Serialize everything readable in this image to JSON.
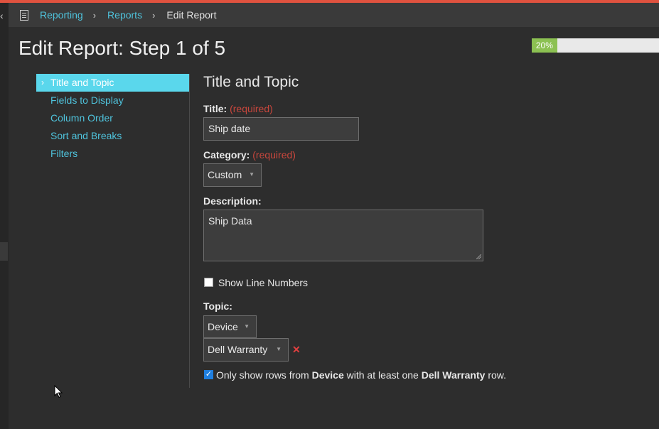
{
  "breadcrumb": {
    "items": [
      "Reporting",
      "Reports"
    ],
    "current": "Edit Report",
    "separator": "›"
  },
  "page_title": "Edit Report: Step 1 of 5",
  "progress": {
    "percent": 20,
    "label": "20%"
  },
  "nav": {
    "items": [
      {
        "label": "Title and Topic",
        "active": true
      },
      {
        "label": "Fields to Display"
      },
      {
        "label": "Column Order"
      },
      {
        "label": "Sort and Breaks"
      },
      {
        "label": "Filters"
      }
    ]
  },
  "form": {
    "section_title": "Title and Topic",
    "title_label": "Title:",
    "required_text": "(required)",
    "title_value": "Ship date",
    "category_label": "Category:",
    "category_value": "Custom",
    "description_label": "Description:",
    "description_value": "Ship Data",
    "show_line_numbers_label": "Show Line Numbers",
    "show_line_numbers_checked": false,
    "topic_label": "Topic:",
    "topic_primary": "Device",
    "topic_secondary": "Dell Warranty",
    "only_show": {
      "checked": true,
      "prefix": "Only show rows from",
      "primary": "Device",
      "middle": "with at least one",
      "secondary": "Dell Warranty",
      "suffix": "row."
    }
  },
  "colors": {
    "accent": "#4fc3dc",
    "active_nav": "#5ad7ec",
    "progress": "#8cc152",
    "required": "#c9473d",
    "top_bar": "#e0523f"
  },
  "icons": {
    "back": "chevron-left-icon",
    "report": "document-icon",
    "remove": "remove-x-icon",
    "caret": "caret-down-icon"
  }
}
